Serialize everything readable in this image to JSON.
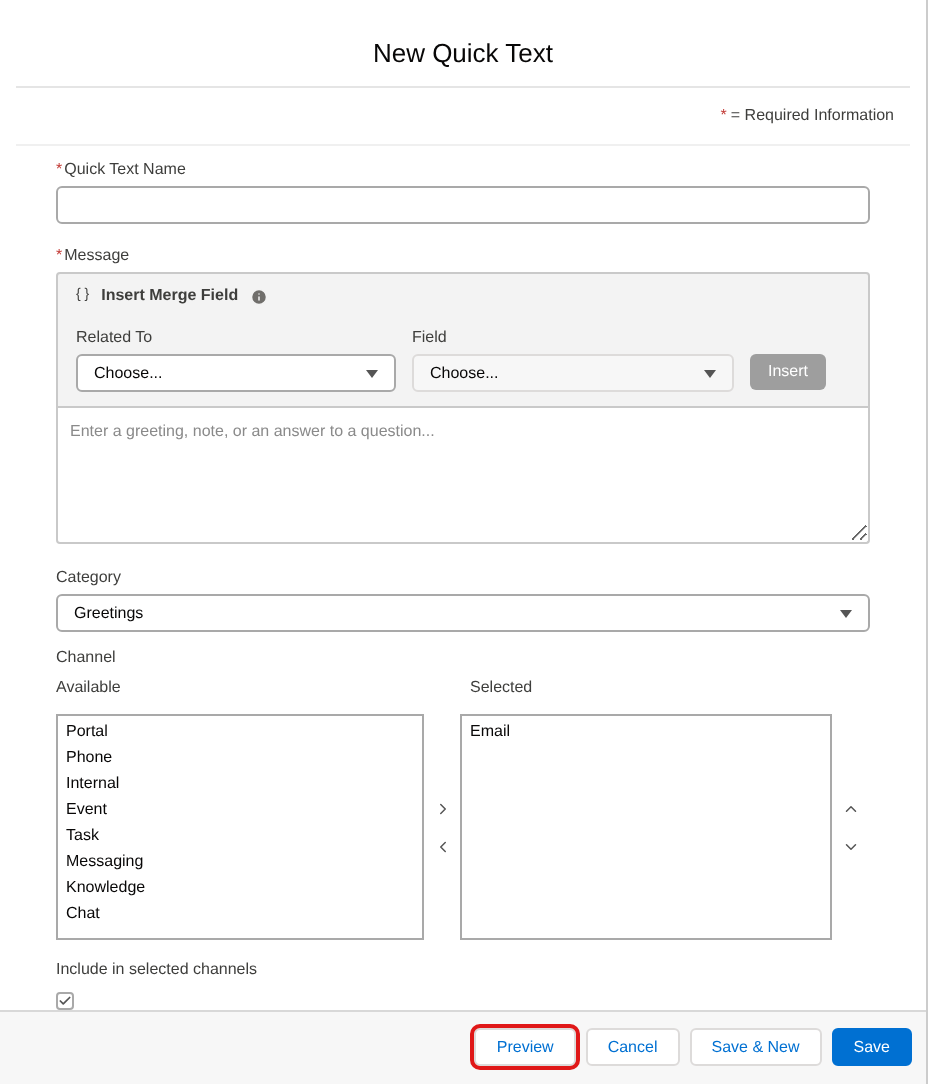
{
  "title": "New Quick Text",
  "required_note": {
    "mark": "*",
    "text": "= Required Information"
  },
  "name_field": {
    "label": "Quick Text Name",
    "required": true
  },
  "message": {
    "label": "Message",
    "required": true,
    "merge_toggle": "{ }",
    "merge_title": "Insert Merge Field",
    "related_to": {
      "label": "Related To",
      "value": "Choose..."
    },
    "field": {
      "label": "Field",
      "value": "Choose..."
    },
    "insert_button": {
      "label": "Insert",
      "disabled": true
    },
    "placeholder": "Enter a greeting, note, or an answer to a question..."
  },
  "category": {
    "label": "Category",
    "value": "Greetings"
  },
  "channel": {
    "label": "Channel",
    "available_label": "Available",
    "selected_label": "Selected",
    "available": [
      "Portal",
      "Phone",
      "Internal",
      "Event",
      "Task",
      "Messaging",
      "Knowledge",
      "Chat"
    ],
    "selected": [
      "Email"
    ]
  },
  "include": {
    "label": "Include in selected channels",
    "checked": true
  },
  "buttons": [
    {
      "label": "Preview",
      "kind": "neutral",
      "highlighted": true
    },
    {
      "label": "Cancel",
      "kind": "neutral",
      "highlighted": false
    },
    {
      "label": "Save & New",
      "kind": "neutral",
      "highlighted": false
    },
    {
      "label": "Save",
      "kind": "brand",
      "highlighted": false
    }
  ]
}
